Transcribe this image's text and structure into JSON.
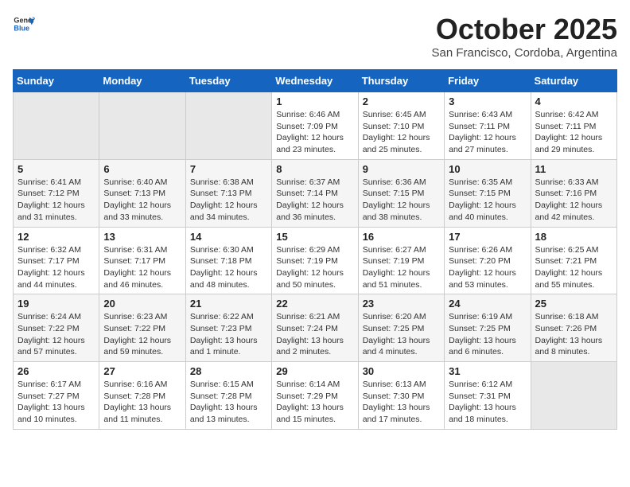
{
  "header": {
    "logo_general": "General",
    "logo_blue": "Blue",
    "month_title": "October 2025",
    "subtitle": "San Francisco, Cordoba, Argentina"
  },
  "days_of_week": [
    "Sunday",
    "Monday",
    "Tuesday",
    "Wednesday",
    "Thursday",
    "Friday",
    "Saturday"
  ],
  "weeks": [
    {
      "row_class": "row-odd",
      "days": [
        {
          "number": "",
          "sunrise": "",
          "sunset": "",
          "daylight": "",
          "empty": true
        },
        {
          "number": "",
          "sunrise": "",
          "sunset": "",
          "daylight": "",
          "empty": true
        },
        {
          "number": "",
          "sunrise": "",
          "sunset": "",
          "daylight": "",
          "empty": true
        },
        {
          "number": "1",
          "sunrise": "Sunrise: 6:46 AM",
          "sunset": "Sunset: 7:09 PM",
          "daylight": "Daylight: 12 hours and 23 minutes."
        },
        {
          "number": "2",
          "sunrise": "Sunrise: 6:45 AM",
          "sunset": "Sunset: 7:10 PM",
          "daylight": "Daylight: 12 hours and 25 minutes."
        },
        {
          "number": "3",
          "sunrise": "Sunrise: 6:43 AM",
          "sunset": "Sunset: 7:11 PM",
          "daylight": "Daylight: 12 hours and 27 minutes."
        },
        {
          "number": "4",
          "sunrise": "Sunrise: 6:42 AM",
          "sunset": "Sunset: 7:11 PM",
          "daylight": "Daylight: 12 hours and 29 minutes."
        }
      ]
    },
    {
      "row_class": "row-even",
      "days": [
        {
          "number": "5",
          "sunrise": "Sunrise: 6:41 AM",
          "sunset": "Sunset: 7:12 PM",
          "daylight": "Daylight: 12 hours and 31 minutes."
        },
        {
          "number": "6",
          "sunrise": "Sunrise: 6:40 AM",
          "sunset": "Sunset: 7:13 PM",
          "daylight": "Daylight: 12 hours and 33 minutes."
        },
        {
          "number": "7",
          "sunrise": "Sunrise: 6:38 AM",
          "sunset": "Sunset: 7:13 PM",
          "daylight": "Daylight: 12 hours and 34 minutes."
        },
        {
          "number": "8",
          "sunrise": "Sunrise: 6:37 AM",
          "sunset": "Sunset: 7:14 PM",
          "daylight": "Daylight: 12 hours and 36 minutes."
        },
        {
          "number": "9",
          "sunrise": "Sunrise: 6:36 AM",
          "sunset": "Sunset: 7:15 PM",
          "daylight": "Daylight: 12 hours and 38 minutes."
        },
        {
          "number": "10",
          "sunrise": "Sunrise: 6:35 AM",
          "sunset": "Sunset: 7:15 PM",
          "daylight": "Daylight: 12 hours and 40 minutes."
        },
        {
          "number": "11",
          "sunrise": "Sunrise: 6:33 AM",
          "sunset": "Sunset: 7:16 PM",
          "daylight": "Daylight: 12 hours and 42 minutes."
        }
      ]
    },
    {
      "row_class": "row-odd",
      "days": [
        {
          "number": "12",
          "sunrise": "Sunrise: 6:32 AM",
          "sunset": "Sunset: 7:17 PM",
          "daylight": "Daylight: 12 hours and 44 minutes."
        },
        {
          "number": "13",
          "sunrise": "Sunrise: 6:31 AM",
          "sunset": "Sunset: 7:17 PM",
          "daylight": "Daylight: 12 hours and 46 minutes."
        },
        {
          "number": "14",
          "sunrise": "Sunrise: 6:30 AM",
          "sunset": "Sunset: 7:18 PM",
          "daylight": "Daylight: 12 hours and 48 minutes."
        },
        {
          "number": "15",
          "sunrise": "Sunrise: 6:29 AM",
          "sunset": "Sunset: 7:19 PM",
          "daylight": "Daylight: 12 hours and 50 minutes."
        },
        {
          "number": "16",
          "sunrise": "Sunrise: 6:27 AM",
          "sunset": "Sunset: 7:19 PM",
          "daylight": "Daylight: 12 hours and 51 minutes."
        },
        {
          "number": "17",
          "sunrise": "Sunrise: 6:26 AM",
          "sunset": "Sunset: 7:20 PM",
          "daylight": "Daylight: 12 hours and 53 minutes."
        },
        {
          "number": "18",
          "sunrise": "Sunrise: 6:25 AM",
          "sunset": "Sunset: 7:21 PM",
          "daylight": "Daylight: 12 hours and 55 minutes."
        }
      ]
    },
    {
      "row_class": "row-even",
      "days": [
        {
          "number": "19",
          "sunrise": "Sunrise: 6:24 AM",
          "sunset": "Sunset: 7:22 PM",
          "daylight": "Daylight: 12 hours and 57 minutes."
        },
        {
          "number": "20",
          "sunrise": "Sunrise: 6:23 AM",
          "sunset": "Sunset: 7:22 PM",
          "daylight": "Daylight: 12 hours and 59 minutes."
        },
        {
          "number": "21",
          "sunrise": "Sunrise: 6:22 AM",
          "sunset": "Sunset: 7:23 PM",
          "daylight": "Daylight: 13 hours and 1 minute."
        },
        {
          "number": "22",
          "sunrise": "Sunrise: 6:21 AM",
          "sunset": "Sunset: 7:24 PM",
          "daylight": "Daylight: 13 hours and 2 minutes."
        },
        {
          "number": "23",
          "sunrise": "Sunrise: 6:20 AM",
          "sunset": "Sunset: 7:25 PM",
          "daylight": "Daylight: 13 hours and 4 minutes."
        },
        {
          "number": "24",
          "sunrise": "Sunrise: 6:19 AM",
          "sunset": "Sunset: 7:25 PM",
          "daylight": "Daylight: 13 hours and 6 minutes."
        },
        {
          "number": "25",
          "sunrise": "Sunrise: 6:18 AM",
          "sunset": "Sunset: 7:26 PM",
          "daylight": "Daylight: 13 hours and 8 minutes."
        }
      ]
    },
    {
      "row_class": "row-odd",
      "days": [
        {
          "number": "26",
          "sunrise": "Sunrise: 6:17 AM",
          "sunset": "Sunset: 7:27 PM",
          "daylight": "Daylight: 13 hours and 10 minutes."
        },
        {
          "number": "27",
          "sunrise": "Sunrise: 6:16 AM",
          "sunset": "Sunset: 7:28 PM",
          "daylight": "Daylight: 13 hours and 11 minutes."
        },
        {
          "number": "28",
          "sunrise": "Sunrise: 6:15 AM",
          "sunset": "Sunset: 7:28 PM",
          "daylight": "Daylight: 13 hours and 13 minutes."
        },
        {
          "number": "29",
          "sunrise": "Sunrise: 6:14 AM",
          "sunset": "Sunset: 7:29 PM",
          "daylight": "Daylight: 13 hours and 15 minutes."
        },
        {
          "number": "30",
          "sunrise": "Sunrise: 6:13 AM",
          "sunset": "Sunset: 7:30 PM",
          "daylight": "Daylight: 13 hours and 17 minutes."
        },
        {
          "number": "31",
          "sunrise": "Sunrise: 6:12 AM",
          "sunset": "Sunset: 7:31 PM",
          "daylight": "Daylight: 13 hours and 18 minutes."
        },
        {
          "number": "",
          "sunrise": "",
          "sunset": "",
          "daylight": "",
          "empty": true
        }
      ]
    }
  ]
}
